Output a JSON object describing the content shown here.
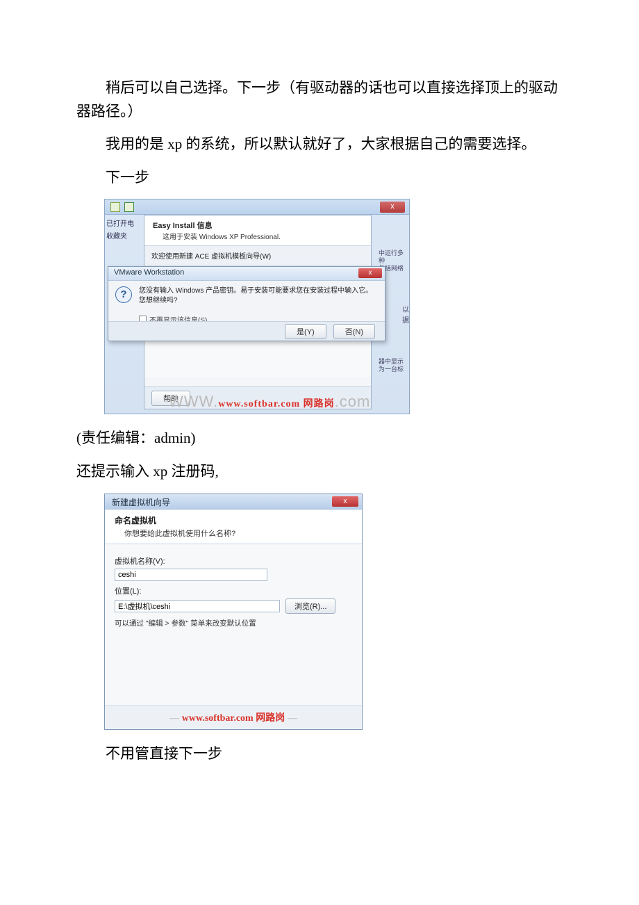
{
  "paragraphs": {
    "p1": "稍后可以自己选择。下一步（有驱动器的话也可以直接选择顶上的驱动器路径。）",
    "p2": "我用的是 xp 的系统，所以默认就好了，大家根据自己的需要选择。",
    "p3": "下一步",
    "p4": "(责任编辑：admin)",
    "p5": "还提示输入 xp 注册码,",
    "p6": "不用管直接下一步"
  },
  "shot1": {
    "top_close": "x",
    "sidebar": {
      "item1": "已打开电",
      "item2": "收藏夹"
    },
    "right_tips": {
      "r1a": "中运行多种",
      "r1b": "包括网络",
      "r2": "以据",
      "r3a": "器中显示",
      "r3b": "为一台标"
    },
    "wizard": {
      "title": "Easy Install 信息",
      "subtitle": "这用于安装 Windows XP Professional.",
      "welcome": "欢迎使用新建 ACE 虚拟机模板向导(W)",
      "help": "帮助"
    },
    "msgbox": {
      "title": "VMware Workstation",
      "close": "x",
      "icon": "?",
      "text": "您没有输入 Windows 产品密钥。易于安装可能要求您在安装过程中输入它。您想继续吗?",
      "checkbox": "不再显示该信息(S)",
      "yes": "是(Y)",
      "no": "否(N)"
    },
    "watermark": {
      "gray": "WWW.",
      "red": "www.softbar.com 网路岗",
      "gray2": ".com"
    }
  },
  "shot2": {
    "window_title": "新建虚拟机向导",
    "close": "x",
    "head": {
      "title": "命名虚拟机",
      "sub": "你想要给此虚拟机使用什么名称?"
    },
    "name_label": "虚拟机名称(V):",
    "name_value": "ceshi",
    "loc_label": "位置(L):",
    "loc_value": "E:\\虚拟机\\ceshi",
    "browse": "浏览(R)...",
    "hint": "可以通过 \"编辑 > 参数\" 菜单来改变默认位置",
    "watermark": "www.softbar.com 网路岗"
  }
}
